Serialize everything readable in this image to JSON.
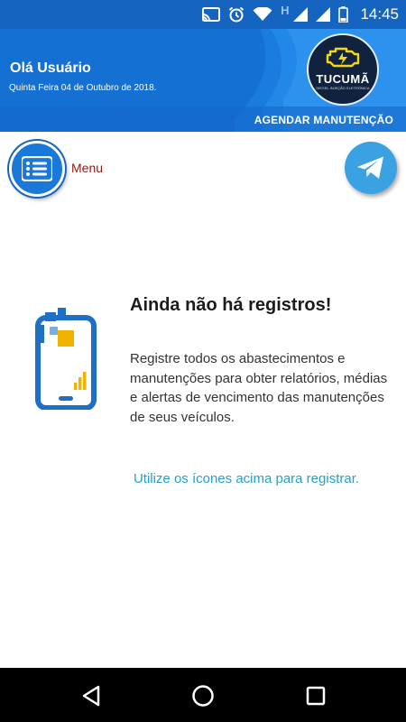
{
  "status_bar": {
    "network_label": "H",
    "time": "14:45",
    "icons": [
      "cast-icon",
      "alarm-icon",
      "wifi-icon",
      "signal-icon",
      "signal-icon",
      "battery-icon"
    ]
  },
  "header": {
    "greeting": "Olá Usuário",
    "date": "Quinta Feira 04 de Outubro de 2018.",
    "logo_name": "TUCUMÃ",
    "logo_tagline": "DIESEL INJEÇÃO ELETRÔNICA",
    "schedule_link": "AGENDAR MANUTENÇÃO"
  },
  "toolbar": {
    "menu_label": "Menu",
    "menu_icon": "list-icon",
    "send_icon": "telegram-icon"
  },
  "empty_state": {
    "title": "Ainda não há registros!",
    "description": "Registre todos os abastecimentos e manutenções para obter relatórios, médias e alertas de vencimento das manutenções de seus veículos.",
    "hint": "Utilize os ícones acima para registrar."
  },
  "colors": {
    "primary": "#1570d3",
    "status_bar": "#1565c0",
    "accent": "#3aa1e3",
    "hint": "#26a0c9",
    "menu_label": "#8b1a1a",
    "logo_bg": "#10223e",
    "logo_yellow": "#f5d90a",
    "illustration_yellow": "#f0b400"
  }
}
